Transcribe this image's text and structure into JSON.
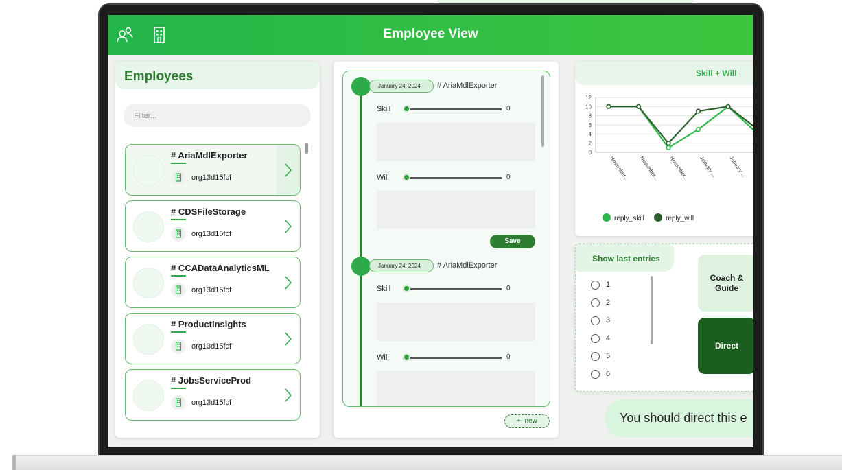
{
  "header": {
    "title": "Employee View",
    "icons": [
      "people-icon",
      "building-icon"
    ],
    "color": "#2eb84a"
  },
  "employees": {
    "title": "Employees",
    "filter_placeholder": "Filter...",
    "items": [
      {
        "name": "# AriaMdlExporter",
        "org": "org13d15fcf",
        "selected": true
      },
      {
        "name": "# CDSFileStorage",
        "org": "org13d15fcf",
        "selected": false
      },
      {
        "name": "# CCADataAnalyticsML",
        "org": "org13d15fcf",
        "selected": false
      },
      {
        "name": "# ProductInsights",
        "org": "org13d15fcf",
        "selected": false
      },
      {
        "name": "# JobsServiceProd",
        "org": "org13d15fcf",
        "selected": false
      }
    ]
  },
  "timeline": {
    "entries": [
      {
        "date": "January 24, 2024",
        "name": "# AriaMdlExporter",
        "skill_label": "Skill",
        "skill_value": "0",
        "will_label": "Will",
        "will_value": "0"
      },
      {
        "date": "January 24, 2024",
        "name": "# AriaMdlExporter",
        "skill_label": "Skill",
        "skill_value": "0",
        "will_label": "Will",
        "will_value": "0"
      }
    ],
    "save_label": "Save",
    "new_label": "new"
  },
  "chart_data": {
    "type": "line",
    "title": "Skill + Will",
    "categories": [
      "November...",
      "November...",
      "November...",
      "January ...",
      "January ...",
      ""
    ],
    "series": [
      {
        "name": "reply_skill",
        "color": "#2eb84a",
        "values": [
          10,
          10,
          1,
          5,
          10,
          4
        ]
      },
      {
        "name": "reply_will",
        "color": "#2e5e2e",
        "values": [
          10,
          10,
          2,
          9,
          10,
          5
        ]
      }
    ],
    "ylim": [
      0,
      12
    ],
    "yticks": [
      "0",
      "2",
      "4",
      "6",
      "8",
      "10",
      "12"
    ],
    "grid": true,
    "legend": "bottom"
  },
  "entries_panel": {
    "title": "Show last entries",
    "options": [
      "1",
      "2",
      "3",
      "4",
      "5",
      "6"
    ],
    "coach_label": "Coach & Guide",
    "direct_label": "Direct"
  },
  "recommendation": {
    "text": "You should direct this e"
  }
}
